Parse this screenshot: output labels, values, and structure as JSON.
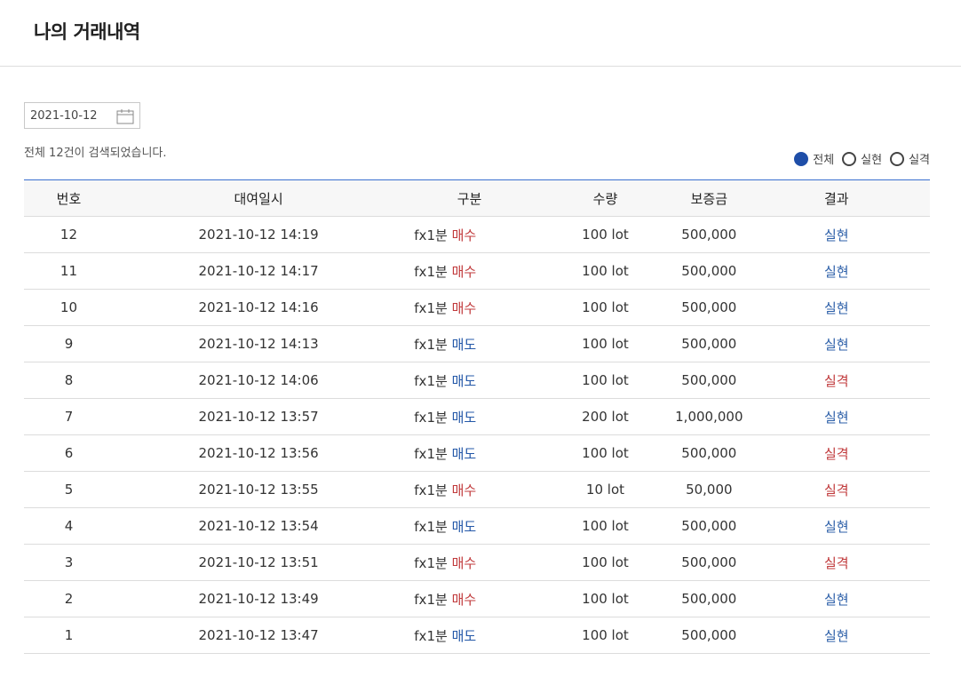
{
  "page": {
    "title": "나의 거래내역"
  },
  "date_filter": {
    "value": "2021-10-12"
  },
  "search": {
    "count_text": "전체 12건이 검색되었습니다."
  },
  "filters": [
    {
      "label": "전체",
      "checked": true
    },
    {
      "label": "실현",
      "checked": false
    },
    {
      "label": "실격",
      "checked": false
    }
  ],
  "table": {
    "headers": [
      "번호",
      "대여일시",
      "구분",
      "수량",
      "보증금",
      "결과"
    ],
    "rows": [
      {
        "no": "12",
        "date": "2021-10-12 14:19",
        "prefix": "fx1분",
        "side": "매수",
        "side_type": "buy",
        "qty": "100 lot",
        "margin": "500,000",
        "result": "실현",
        "result_type": "win"
      },
      {
        "no": "11",
        "date": "2021-10-12 14:17",
        "prefix": "fx1분",
        "side": "매수",
        "side_type": "buy",
        "qty": "100 lot",
        "margin": "500,000",
        "result": "실현",
        "result_type": "win"
      },
      {
        "no": "10",
        "date": "2021-10-12 14:16",
        "prefix": "fx1분",
        "side": "매수",
        "side_type": "buy",
        "qty": "100 lot",
        "margin": "500,000",
        "result": "실현",
        "result_type": "win"
      },
      {
        "no": "9",
        "date": "2021-10-12 14:13",
        "prefix": "fx1분",
        "side": "매도",
        "side_type": "sell",
        "qty": "100 lot",
        "margin": "500,000",
        "result": "실현",
        "result_type": "win"
      },
      {
        "no": "8",
        "date": "2021-10-12 14:06",
        "prefix": "fx1분",
        "side": "매도",
        "side_type": "sell",
        "qty": "100 lot",
        "margin": "500,000",
        "result": "실격",
        "result_type": "lose"
      },
      {
        "no": "7",
        "date": "2021-10-12 13:57",
        "prefix": "fx1분",
        "side": "매도",
        "side_type": "sell",
        "qty": "200 lot",
        "margin": "1,000,000",
        "result": "실현",
        "result_type": "win"
      },
      {
        "no": "6",
        "date": "2021-10-12 13:56",
        "prefix": "fx1분",
        "side": "매도",
        "side_type": "sell",
        "qty": "100 lot",
        "margin": "500,000",
        "result": "실격",
        "result_type": "lose"
      },
      {
        "no": "5",
        "date": "2021-10-12 13:55",
        "prefix": "fx1분",
        "side": "매수",
        "side_type": "buy",
        "qty": "10 lot",
        "margin": "50,000",
        "result": "실격",
        "result_type": "lose"
      },
      {
        "no": "4",
        "date": "2021-10-12 13:54",
        "prefix": "fx1분",
        "side": "매도",
        "side_type": "sell",
        "qty": "100 lot",
        "margin": "500,000",
        "result": "실현",
        "result_type": "win"
      },
      {
        "no": "3",
        "date": "2021-10-12 13:51",
        "prefix": "fx1분",
        "side": "매수",
        "side_type": "buy",
        "qty": "100 lot",
        "margin": "500,000",
        "result": "실격",
        "result_type": "lose"
      },
      {
        "no": "2",
        "date": "2021-10-12 13:49",
        "prefix": "fx1분",
        "side": "매수",
        "side_type": "buy",
        "qty": "100 lot",
        "margin": "500,000",
        "result": "실현",
        "result_type": "win"
      },
      {
        "no": "1",
        "date": "2021-10-12 13:47",
        "prefix": "fx1분",
        "side": "매도",
        "side_type": "sell",
        "qty": "100 lot",
        "margin": "500,000",
        "result": "실현",
        "result_type": "win"
      }
    ]
  },
  "colors": {
    "accent": "#1f4ea8",
    "buy": "#c0393b",
    "sell": "#2458a8",
    "table_top_border": "#3a6fd0"
  },
  "icons": {
    "calendar": "calendar-icon"
  }
}
